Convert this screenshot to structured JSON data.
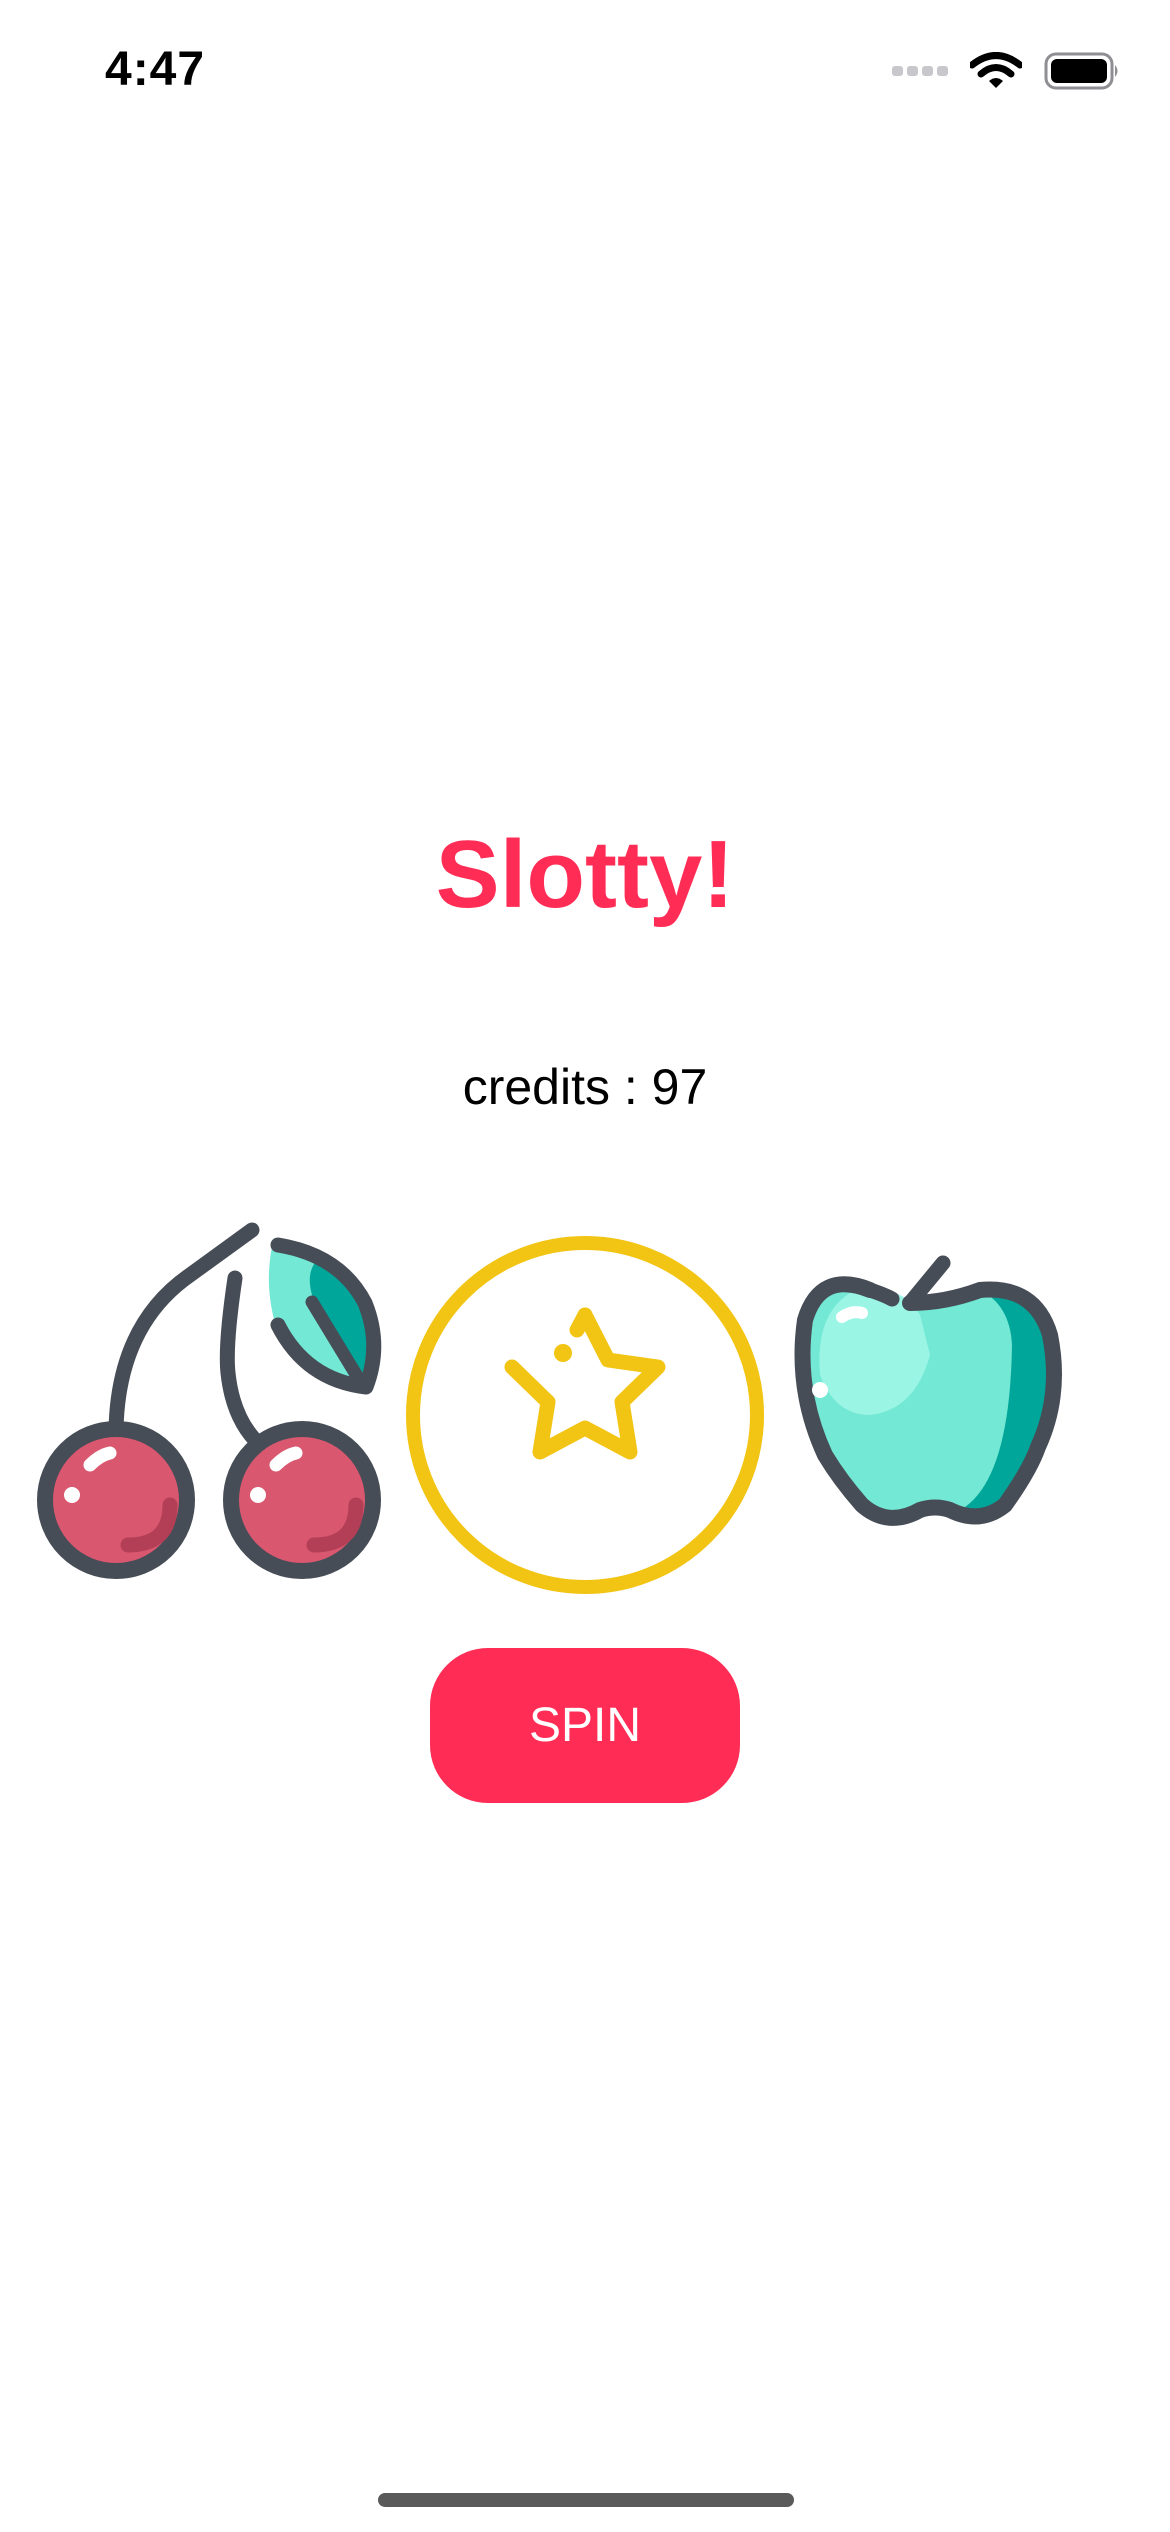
{
  "status_bar": {
    "time": "4:47",
    "icons": [
      "cellular-signal-icon",
      "wifi-icon",
      "battery-icon"
    ]
  },
  "app": {
    "title": "Slotty!",
    "credits_text": "credits : 97",
    "spin_label": "SPIN"
  },
  "reels": [
    {
      "symbol": "cherries-icon"
    },
    {
      "symbol": "star-coin-icon"
    },
    {
      "symbol": "apple-icon"
    }
  ],
  "colors": {
    "accent": "#ff2d55",
    "star_coin": "#f2c414",
    "outline": "#474d57",
    "cherry_red": "#d9576f",
    "leaf_mint": "#73e8d5",
    "leaf_teal": "#00a699"
  }
}
